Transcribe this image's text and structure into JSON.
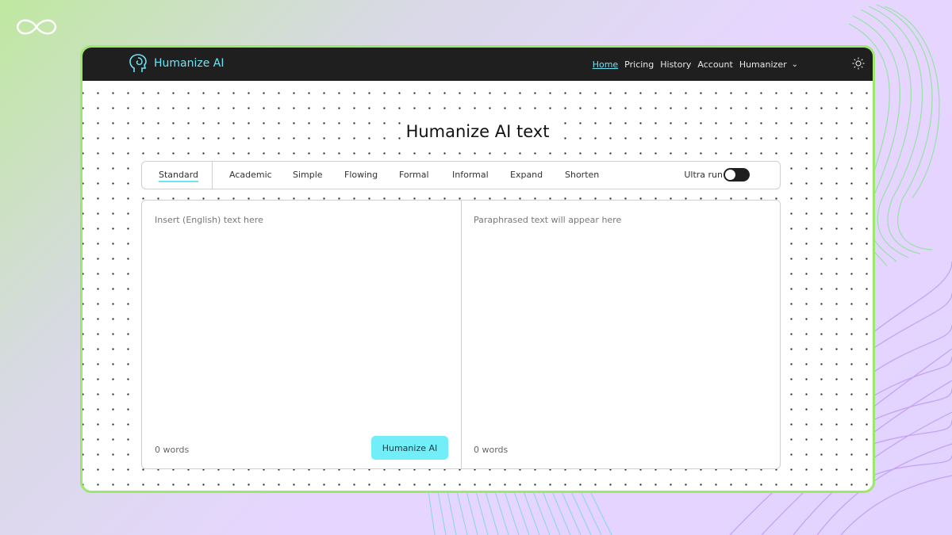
{
  "brand": {
    "name": "Humanize AI"
  },
  "nav": {
    "home": "Home",
    "pricing": "Pricing",
    "history": "History",
    "account": "Account",
    "humanizer": "Humanizer"
  },
  "page": {
    "title": "Humanize AI text"
  },
  "modes": [
    "Standard",
    "Academic",
    "Simple",
    "Flowing",
    "Formal",
    "Informal",
    "Expand",
    "Shorten"
  ],
  "selected_mode": "Standard",
  "ultra_run": {
    "label": "Ultra run",
    "enabled": false
  },
  "input_pane": {
    "placeholder": "Insert (English) text here",
    "word_count": "0 words"
  },
  "output_pane": {
    "placeholder": "Paraphrased text will appear here",
    "word_count": "0 words"
  },
  "action": {
    "humanize_label": "Humanize AI"
  },
  "colors": {
    "accent": "#6fe3f2",
    "frame_border": "#9be86d",
    "topbar": "#1f1f1f",
    "button": "#72eef8"
  }
}
